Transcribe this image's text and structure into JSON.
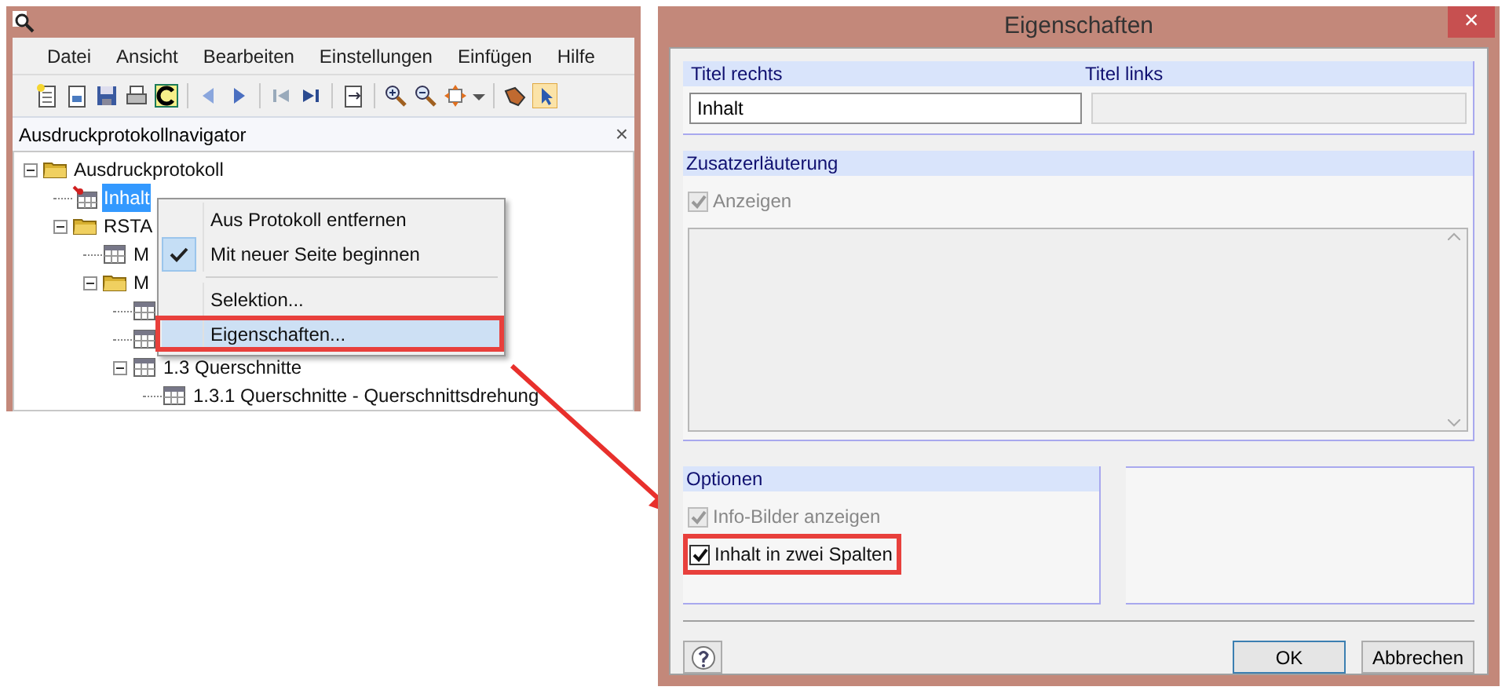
{
  "main_window": {
    "menu": [
      "Datei",
      "Ansicht",
      "Bearbeiten",
      "Einstellungen",
      "Einfügen",
      "Hilfe"
    ],
    "navigator": {
      "title": "Ausdruckprotokollnavigator",
      "close": "×",
      "tree": [
        {
          "label": "Ausdruckprotokoll",
          "kind": "folder",
          "expanded": true,
          "selected": false,
          "children": [
            {
              "label": "Inhalt",
              "kind": "pinned",
              "selected": true
            },
            {
              "label": "RSTA",
              "kind": "folder",
              "expanded": true,
              "selected": false,
              "children": [
                {
                  "label": "M",
                  "kind": "table",
                  "selected": false
                },
                {
                  "label": "M",
                  "kind": "folder",
                  "expanded": true,
                  "selected": false,
                  "children": [
                    {
                      "kind": "table",
                      "selected": false
                    },
                    {
                      "kind": "table",
                      "selected": false
                    },
                    {
                      "label": "1.3 Querschnitte",
                      "kind": "table",
                      "expanded": true,
                      "selected": false,
                      "children": [
                        {
                          "label": "1.3.1 Querschnitte  - Querschnittsdrehung",
                          "kind": "table",
                          "selected": false
                        }
                      ]
                    }
                  ]
                }
              ]
            }
          ]
        }
      ]
    }
  },
  "context_menu": [
    {
      "label": "Aus Protokoll entfernen",
      "checked": false,
      "selected": false
    },
    {
      "label": "Mit neuer Seite beginnen",
      "checked": true,
      "selected": false
    },
    {
      "kind": "separator"
    },
    {
      "label": "Selektion...",
      "checked": false,
      "selected": false
    },
    {
      "label": "Eigenschaften...",
      "checked": false,
      "selected": true
    }
  ],
  "dialog": {
    "title": "Eigenschaften",
    "close": "×",
    "titles": {
      "right_label": "Titel rechts",
      "left_label": "Titel links",
      "right_value": "Inhalt",
      "left_disabled": true
    },
    "note": {
      "header": "Zusatzerläuterung",
      "show": {
        "label": "Anzeigen",
        "checked": true,
        "disabled": true
      },
      "text_disabled": true
    },
    "options": {
      "header": "Optionen",
      "items": [
        {
          "label": "Info-Bilder anzeigen",
          "checked": true,
          "disabled": true
        },
        {
          "label": "Inhalt in zwei Spalten",
          "checked": true,
          "disabled": false
        }
      ]
    },
    "buttons": [
      "OK",
      "Abbrechen"
    ]
  }
}
